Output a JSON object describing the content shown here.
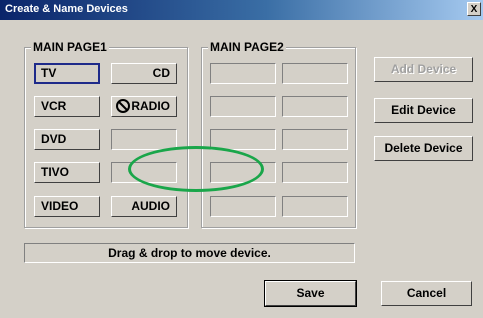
{
  "window": {
    "title": "Create & Name Devices",
    "close_label": "X"
  },
  "page1": {
    "label": "MAIN PAGE1",
    "devices": {
      "tv": "TV",
      "cd": "CD",
      "vcr": "VCR",
      "radio": "RADIO",
      "dvd": "DVD",
      "tivo": "TIVO",
      "video": "VIDEO",
      "audio": "AUDIO"
    }
  },
  "page2": {
    "label": "MAIN PAGE2"
  },
  "buttons": {
    "add_device": "Add Device",
    "edit_device": "Edit Device",
    "delete_device": "Delete Device",
    "save": "Save",
    "cancel": "Cancel"
  },
  "status_text": "Drag & drop to move device.",
  "icons": {
    "no_drop": "no-drop-icon"
  },
  "colors": {
    "title_bar": "#0a246a",
    "selection_border": "#1e2a8a",
    "annotation_ellipse": "#1aa64a"
  }
}
